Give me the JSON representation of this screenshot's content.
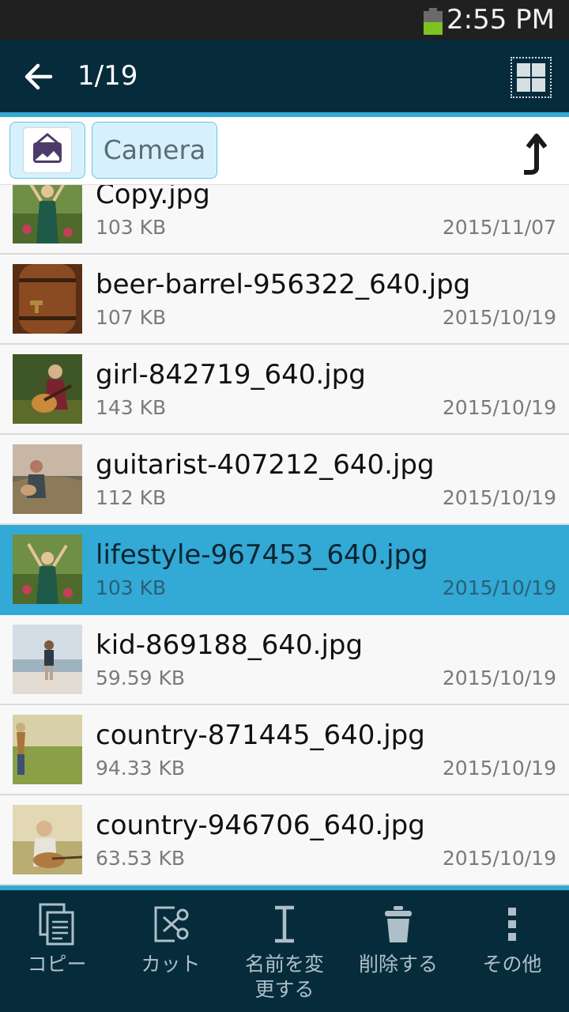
{
  "status_bar": {
    "time": "2:55 PM"
  },
  "app_bar": {
    "page_count": "1/19"
  },
  "path_bar": {
    "folder": "Camera"
  },
  "files": [
    {
      "name": "Copy.jpg",
      "size": "103 KB",
      "date": "2015/11/07",
      "selected": false
    },
    {
      "name": "beer-barrel-956322_640.jpg",
      "size": "107 KB",
      "date": "2015/10/19",
      "selected": false
    },
    {
      "name": "girl-842719_640.jpg",
      "size": "143 KB",
      "date": "2015/10/19",
      "selected": false
    },
    {
      "name": "guitarist-407212_640.jpg",
      "size": "112 KB",
      "date": "2015/10/19",
      "selected": false
    },
    {
      "name": "lifestyle-967453_640.jpg",
      "size": "103 KB",
      "date": "2015/10/19",
      "selected": true
    },
    {
      "name": "kid-869188_640.jpg",
      "size": "59.59 KB",
      "date": "2015/10/19",
      "selected": false
    },
    {
      "name": "country-871445_640.jpg",
      "size": "94.33 KB",
      "date": "2015/10/19",
      "selected": false
    },
    {
      "name": "country-946706_640.jpg",
      "size": "63.53 KB",
      "date": "2015/10/19",
      "selected": false
    }
  ],
  "actions": [
    {
      "label": "コピー",
      "icon": "copy-icon"
    },
    {
      "label": "カット",
      "icon": "cut-icon"
    },
    {
      "label": "名前を変更する",
      "icon": "rename-icon"
    },
    {
      "label": "削除する",
      "icon": "trash-icon"
    },
    {
      "label": "その他",
      "icon": "more-icon"
    }
  ],
  "colors": {
    "app_bar": "#062c3c",
    "accent": "#33a9d5",
    "selected_row": "#33a9d5",
    "chip_bg": "#d6f1fb"
  }
}
